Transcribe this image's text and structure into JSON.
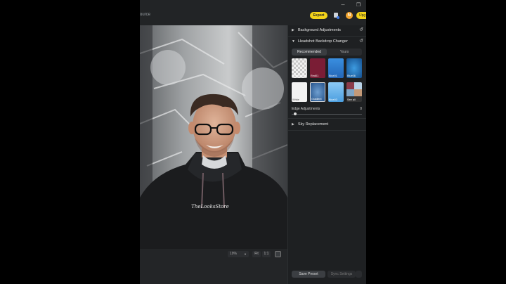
{
  "window": {
    "title_fragment": "ource"
  },
  "header": {
    "export_label": "Export",
    "avatar_initial": "N",
    "upgrade_label": "Upg"
  },
  "zoom": {
    "level": "19%",
    "fit_label": "Fit",
    "one_to_one_label": "1:1"
  },
  "panel": {
    "background_adjustments": "Background Adjustments",
    "headshot_backdrop_changer": "Headshot Backdrop Changer",
    "tabs": [
      {
        "label": "Recommended",
        "active": true
      },
      {
        "label": "Yours",
        "active": false
      }
    ],
    "presets": [
      {
        "label": "Transparent",
        "color": "#bfbfbf"
      },
      {
        "label": "Red01",
        "color": "#7a1d35"
      },
      {
        "label": "Blue01",
        "color": "#2f82d6"
      },
      {
        "label": "Blue06",
        "color": "#1f6fb3"
      },
      {
        "label": "White",
        "color": "#f2f2f2"
      },
      {
        "label": "Gradient",
        "color": "#3a6aa8"
      },
      {
        "label": "Blue03",
        "color": "#6fb6ec"
      },
      {
        "label": "See all",
        "color": "#8b3b4a"
      }
    ],
    "edge_adjustments_label": "Edge Adjustments",
    "edge_adjustments_value": "0",
    "sky_replacement": "Sky Replacement",
    "save_preset_label": "Save Preset",
    "sync_settings_label": "Sync Settings"
  },
  "photo": {
    "hoodie_text": "TheLooksStore"
  }
}
